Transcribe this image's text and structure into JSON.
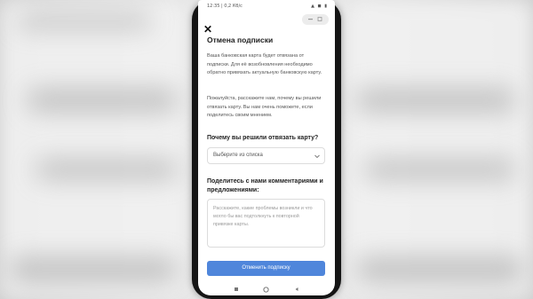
{
  "status_bar": {
    "time_and_speed": "12:35 | 0,2 Кб/с",
    "icons": "▲ ◼ ▮"
  },
  "screen": {
    "title": "Отмена подписки",
    "paragraph1": "Ваша банковская карта будет отвязана от подписки. Для её возобновления необходимо обратно привязать актуальную банковскую карту.",
    "paragraph2": "Пожалуйста, расскажите нам, почему вы решили отвязать карту. Вы нам очень поможете, если поделитесь своим мнением.",
    "question_reason": "Почему вы решили отвязать карту?",
    "select": {
      "placeholder": "Выберите из списка"
    },
    "question_comments": "Поделитесь с нами комментариями и предложениями:",
    "textarea": {
      "placeholder": "Расскажите, какие проблемы возникли и что могло бы вас подтолкнуть к повторной привязке карты."
    },
    "submit_button": "Отменить подписку"
  },
  "colors": {
    "accent": "#4f86db",
    "phone_frame": "#151515",
    "background": "#d9d9d9"
  },
  "icons": [
    "close-icon",
    "chevron-down-icon",
    "wifi-icon",
    "battery-icon",
    "nav-square-icon",
    "nav-circle-icon",
    "nav-back-icon"
  ]
}
